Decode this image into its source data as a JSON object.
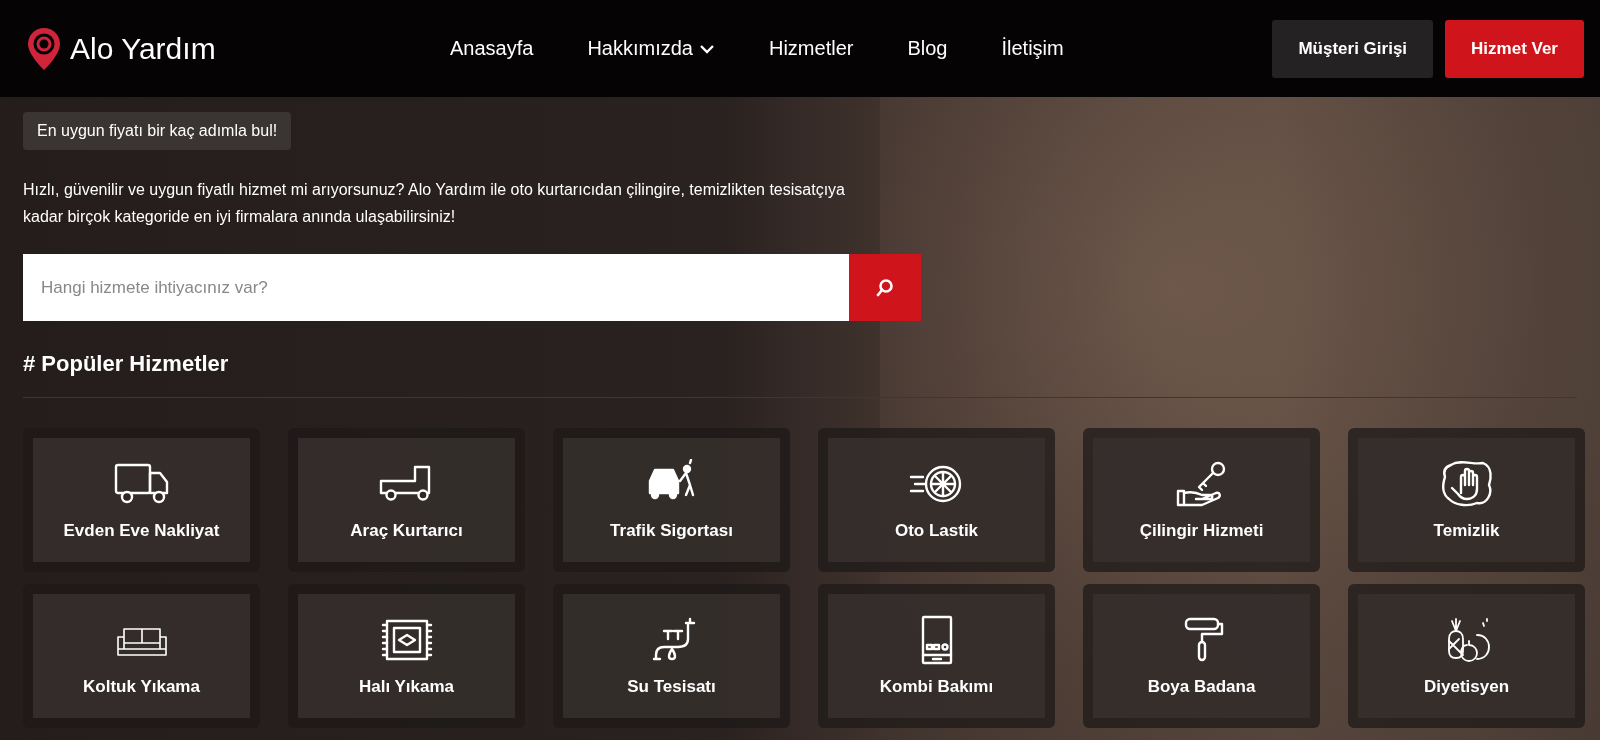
{
  "header": {
    "logo": "Alo Yardım",
    "nav": [
      {
        "label": "Anasayfa",
        "dropdown": false
      },
      {
        "label": "Hakkımızda",
        "dropdown": true
      },
      {
        "label": "Hizmetler",
        "dropdown": false
      },
      {
        "label": "Blog",
        "dropdown": false
      },
      {
        "label": "İletişim",
        "dropdown": false
      }
    ],
    "buttons": [
      {
        "label": "Müşteri Girişi",
        "kind": "secondary"
      },
      {
        "label": "Hizmet Ver",
        "kind": "primary"
      }
    ]
  },
  "hero": {
    "badge": "En uygun fiyatı bir kaç adımla bul!",
    "text": "Hızlı, güvenilir ve uygun fiyatlı hizmet mi arıyorsunuz? Alo Yardım ile oto kurtarıcıdan çilingire, temizlikten tesisatçıya kadar birçok kategoride en iyi firmalara anında ulaşabilirsiniz!",
    "search": {
      "placeholder": "Hangi hizmete ihtiyacınız var?"
    }
  },
  "popular": {
    "title": "# Popüler Hizmetler",
    "services": [
      {
        "label": "Evden Eve Nakliyat"
      },
      {
        "label": "Araç Kurtarıcı"
      },
      {
        "label": "Trafik Sigortası"
      },
      {
        "label": "Oto Lastik"
      },
      {
        "label": "Çilingir Hizmeti"
      },
      {
        "label": "Temizlik"
      },
      {
        "label": "Koltuk Yıkama"
      },
      {
        "label": "Halı Yıkama"
      },
      {
        "label": "Su Tesisatı"
      },
      {
        "label": "Kombi Bakımı"
      },
      {
        "label": "Boya Badana"
      },
      {
        "label": "Diyetisyen"
      }
    ]
  }
}
